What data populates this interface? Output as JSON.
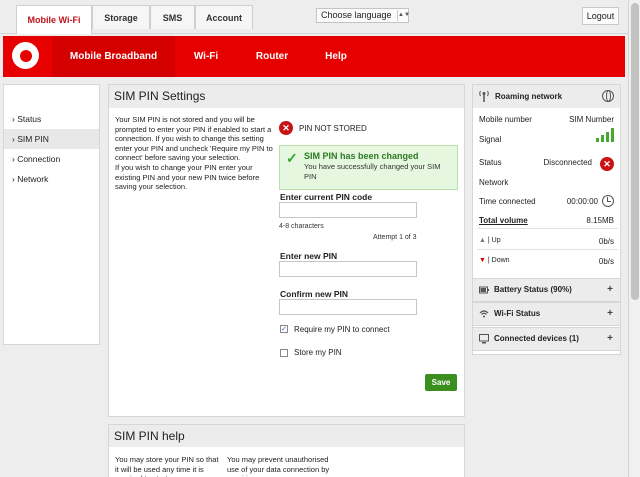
{
  "top_tabs": [
    "Mobile Wi-Fi",
    "Storage",
    "SMS",
    "Account"
  ],
  "language": "Choose language",
  "logout_label": "Logout",
  "nav": [
    "Mobile Broadband",
    "Wi-Fi",
    "Router",
    "Help"
  ],
  "sidebar": [
    {
      "label": "› Status",
      "active": false
    },
    {
      "label": "› SIM PIN",
      "active": true
    },
    {
      "label": "› Connection",
      "active": false
    },
    {
      "label": "› Network",
      "active": false
    }
  ],
  "main": {
    "title": "SIM PIN Settings",
    "intro_1": "Your SIM PIN is not stored and you will be prompted to enter your PIN if enabled to start a connection. If you wish to change this setting enter your PIN and uncheck 'Require my PIN to connect' before saving your selection.",
    "intro_2": "If you wish to change your PIN enter your existing PIN and your new PIN twice before saving your selection.",
    "pin_status": "PIN NOT STORED",
    "success_title": "SIM PIN has been changed",
    "success_text": "You have successfully changed your SIM PIN",
    "current_pin_label": "Enter current PIN code",
    "chars_hint": "4-8 characters",
    "attempt": "Attempt 1 of 3",
    "new_pin_label": "Enter new PIN",
    "confirm_pin_label": "Confirm new PIN",
    "require_label": "Require my PIN to connect",
    "require_checked": true,
    "store_label": "Store my PIN",
    "store_checked": false,
    "save_label": "Save"
  },
  "help": {
    "title": "SIM PIN help",
    "col1": "You may store your PIN so that it will be used any time it is required to start a",
    "col2": "You may prevent unauthorised use of your data connection by requiring"
  },
  "status_panel": {
    "header": "Roaming network",
    "mobile_number_label": "Mobile number",
    "mobile_number_value": "SIM Number",
    "signal_label": "Signal",
    "status_label": "Status",
    "status_value": "Disconnected",
    "network_label": "Network",
    "time_label": "Time connected",
    "time_value": "00:00:00",
    "total_label": "Total volume",
    "total_value": "8.15MB",
    "up_label": "Up",
    "up_value": "0b/s",
    "down_label": "Down",
    "down_value": "0b/s"
  },
  "sections": [
    {
      "label": "Battery Status (90%)",
      "icon": "battery-icon"
    },
    {
      "label": "Wi-Fi Status",
      "icon": "wifi-icon"
    },
    {
      "label": "Connected devices (1)",
      "icon": "monitor-icon"
    }
  ],
  "colors": {
    "brand_red": "#e60000",
    "save_green": "#3b8f1e",
    "success_bg": "#e5f7df"
  }
}
